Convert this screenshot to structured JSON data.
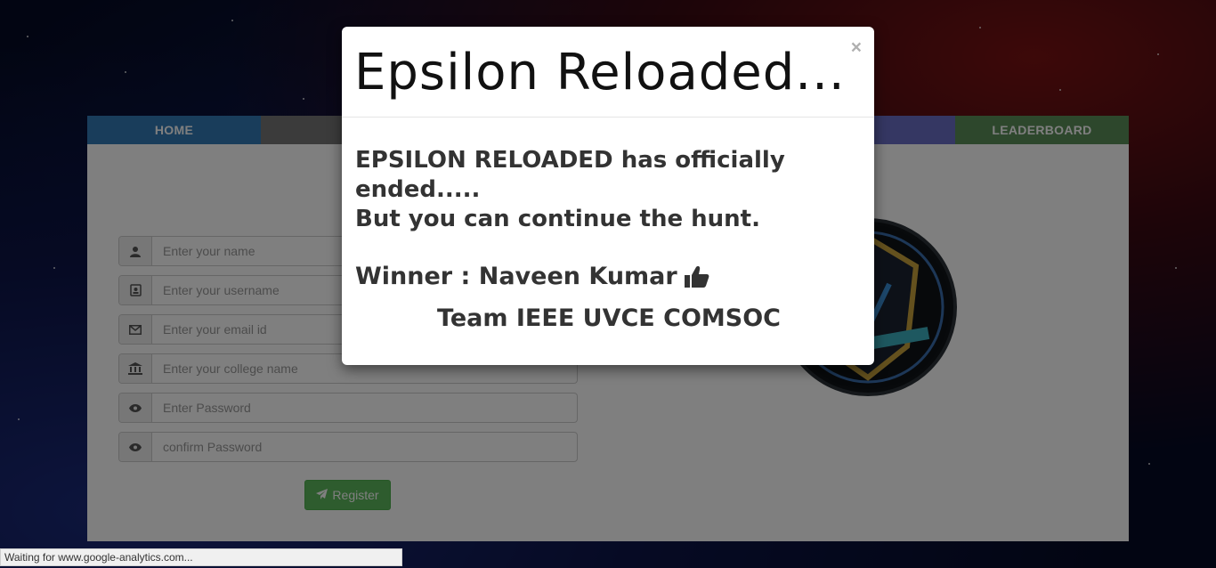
{
  "nav": {
    "items": [
      {
        "label": "HOME",
        "color": "#337ab7"
      },
      {
        "label": "",
        "color": "#777777"
      },
      {
        "label": "",
        "color": "#5bc0de"
      },
      {
        "label": "",
        "color": "#f0ad4e"
      },
      {
        "label": "",
        "color": "#6a6fc7"
      },
      {
        "label": "LEADERBOARD",
        "color": "#5b8f58"
      }
    ]
  },
  "form": {
    "name_placeholder": "Enter your name",
    "username_placeholder": "Enter your username",
    "email_placeholder": "Enter your email id",
    "college_placeholder": "Enter your college name",
    "password_placeholder": "Enter Password",
    "confirm_placeholder": "confirm Password",
    "register_label": "Register"
  },
  "modal": {
    "title": "Epsilon Reloaded...",
    "close": "×",
    "line1": "EPSILON RELOADED has officially ended.....",
    "line2": "But you can continue the hunt.",
    "winner_label": "Winner",
    "winner_sep": " : ",
    "winner_name": "Naveen Kumar",
    "team": "Team IEEE UVCE COMSOC"
  },
  "status_bar": {
    "text": "Waiting for www.google-analytics.com..."
  },
  "icons": {
    "name": "user-icon",
    "username": "id-card-icon",
    "email": "envelope-icon",
    "college": "bank-icon",
    "password": "eye-icon",
    "confirm": "eye-icon",
    "register": "paper-plane-icon",
    "winner": "thumbs-up-icon"
  }
}
